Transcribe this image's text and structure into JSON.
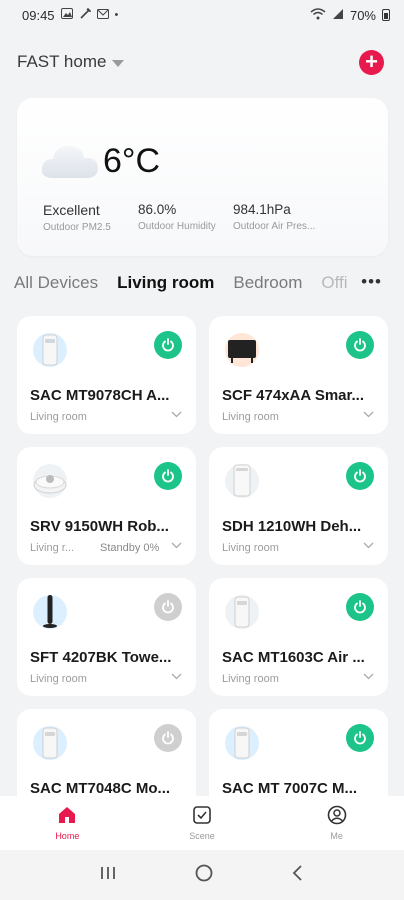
{
  "status_bar": {
    "time": "09:45",
    "battery": "70%"
  },
  "header": {
    "home_name": "FAST home"
  },
  "weather": {
    "temperature": "6°C",
    "metrics": [
      {
        "value": "Excellent",
        "label": "Outdoor PM2.5"
      },
      {
        "value": "86.0%",
        "label": "Outdoor Humidity"
      },
      {
        "value": "984.1hPa",
        "label": "Outdoor Air Pres..."
      }
    ]
  },
  "tabs": [
    "All Devices",
    "Living room",
    "Bedroom",
    "Offi"
  ],
  "devices": [
    {
      "name": "SAC MT9078CH A...",
      "room": "Living room",
      "status": "",
      "power": "on"
    },
    {
      "name": "SCF 474xAA Smar...",
      "room": "Living room",
      "status": "",
      "power": "on"
    },
    {
      "name": "SRV 9150WH Rob...",
      "room": "Living r...",
      "status": "Standby  0%",
      "power": "on"
    },
    {
      "name": "SDH 1210WH Deh...",
      "room": "Living room",
      "status": "",
      "power": "on"
    },
    {
      "name": "SFT 4207BK Towe...",
      "room": "Living room",
      "status": "",
      "power": "off"
    },
    {
      "name": "SAC MT1603C Air ...",
      "room": "Living room",
      "status": "",
      "power": "on"
    },
    {
      "name": "SAC MT7048C Mo...",
      "room": "",
      "status": "",
      "power": "off"
    },
    {
      "name": "SAC MT 7007C M...",
      "room": "",
      "status": "",
      "power": "on"
    }
  ],
  "bottom_nav": [
    {
      "label": "Home",
      "icon": "home-icon",
      "active": true
    },
    {
      "label": "Scene",
      "icon": "scene-icon",
      "active": false
    },
    {
      "label": "Me",
      "icon": "profile-icon",
      "active": false
    }
  ],
  "colors": {
    "accent": "#e8194d",
    "power_on": "#1dc48a",
    "power_off": "#cfcfcf"
  }
}
